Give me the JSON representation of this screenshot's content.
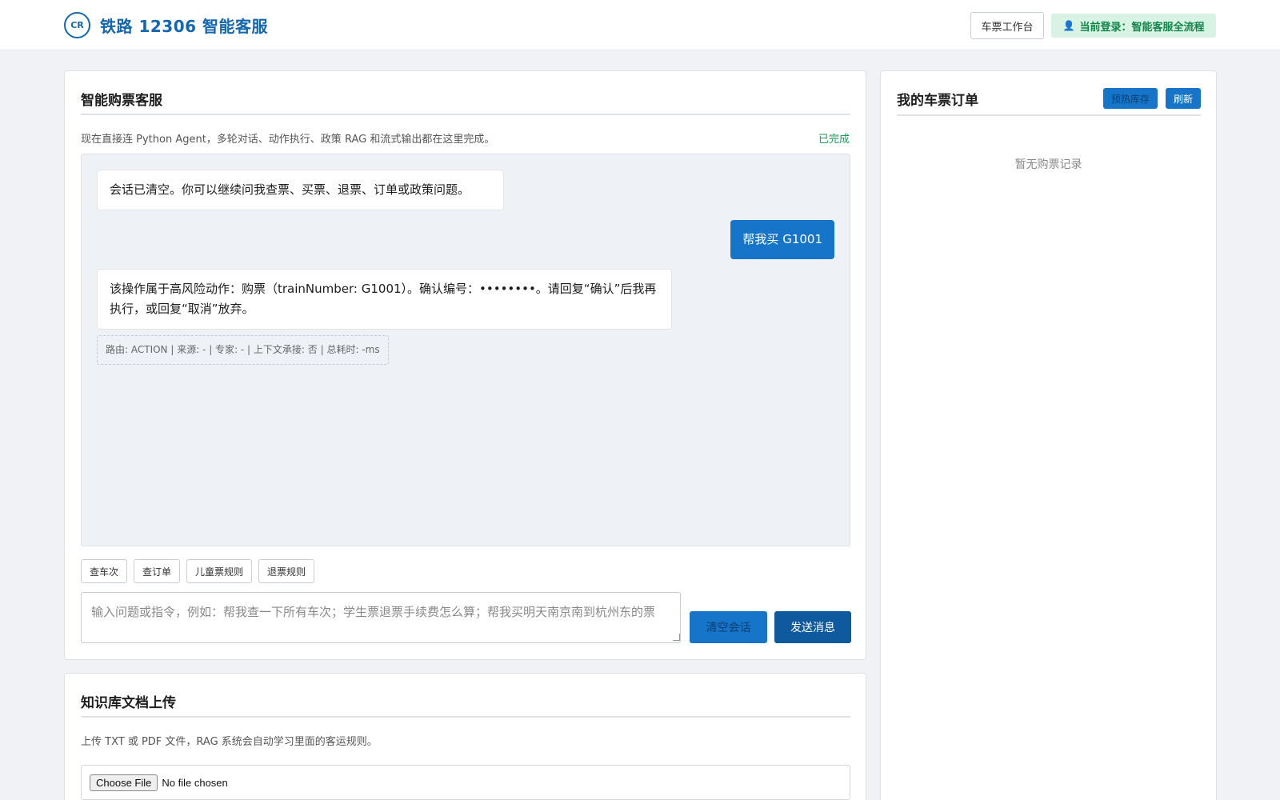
{
  "header": {
    "logo_text": "CR",
    "title": "铁路 12306 智能客服",
    "workbench_label": "车票工作台",
    "login_label": "当前登录：智能客服全流程"
  },
  "chat": {
    "title": "智能购票客服",
    "subtitle": "现在直接连 Python Agent，多轮对话、动作执行、政策 RAG 和流式输出都在这里完成。",
    "status": "已完成",
    "messages": [
      {
        "role": "bot",
        "text": "会话已清空。你可以继续问我查票、买票、退票、订单或政策问题。"
      },
      {
        "role": "user",
        "text": "帮我买 G1001"
      },
      {
        "role": "bot",
        "text": "该操作属于高风险动作：购票（trainNumber: G1001）。确认编号：••••••••。请回复“确认”后我再执行，或回复“取消”放弃。"
      }
    ],
    "route_meta": "路由: ACTION | 来源: - | 专家: - | 上下文承接: 否 | 总耗时: -ms",
    "quick_actions": [
      "查车次",
      "查订单",
      "儿童票规则",
      "退票规则"
    ],
    "input_placeholder": "输入问题或指令，例如：帮我查一下所有车次；学生票退票手续费怎么算；帮我买明天南京南到杭州东的票",
    "clear_label": "清空会话",
    "send_label": "发送消息"
  },
  "orders": {
    "title": "我的车票订单",
    "preheat_label": "预热库存",
    "refresh_label": "刷新",
    "empty_text": "暂无购票记录"
  },
  "knowledge": {
    "title": "知识库文档上传",
    "subtitle": "上传 TXT 或 PDF 文件，RAG 系统会自动学习里面的客运规则。",
    "file_button": "Choose File",
    "file_status": "No file chosen"
  }
}
